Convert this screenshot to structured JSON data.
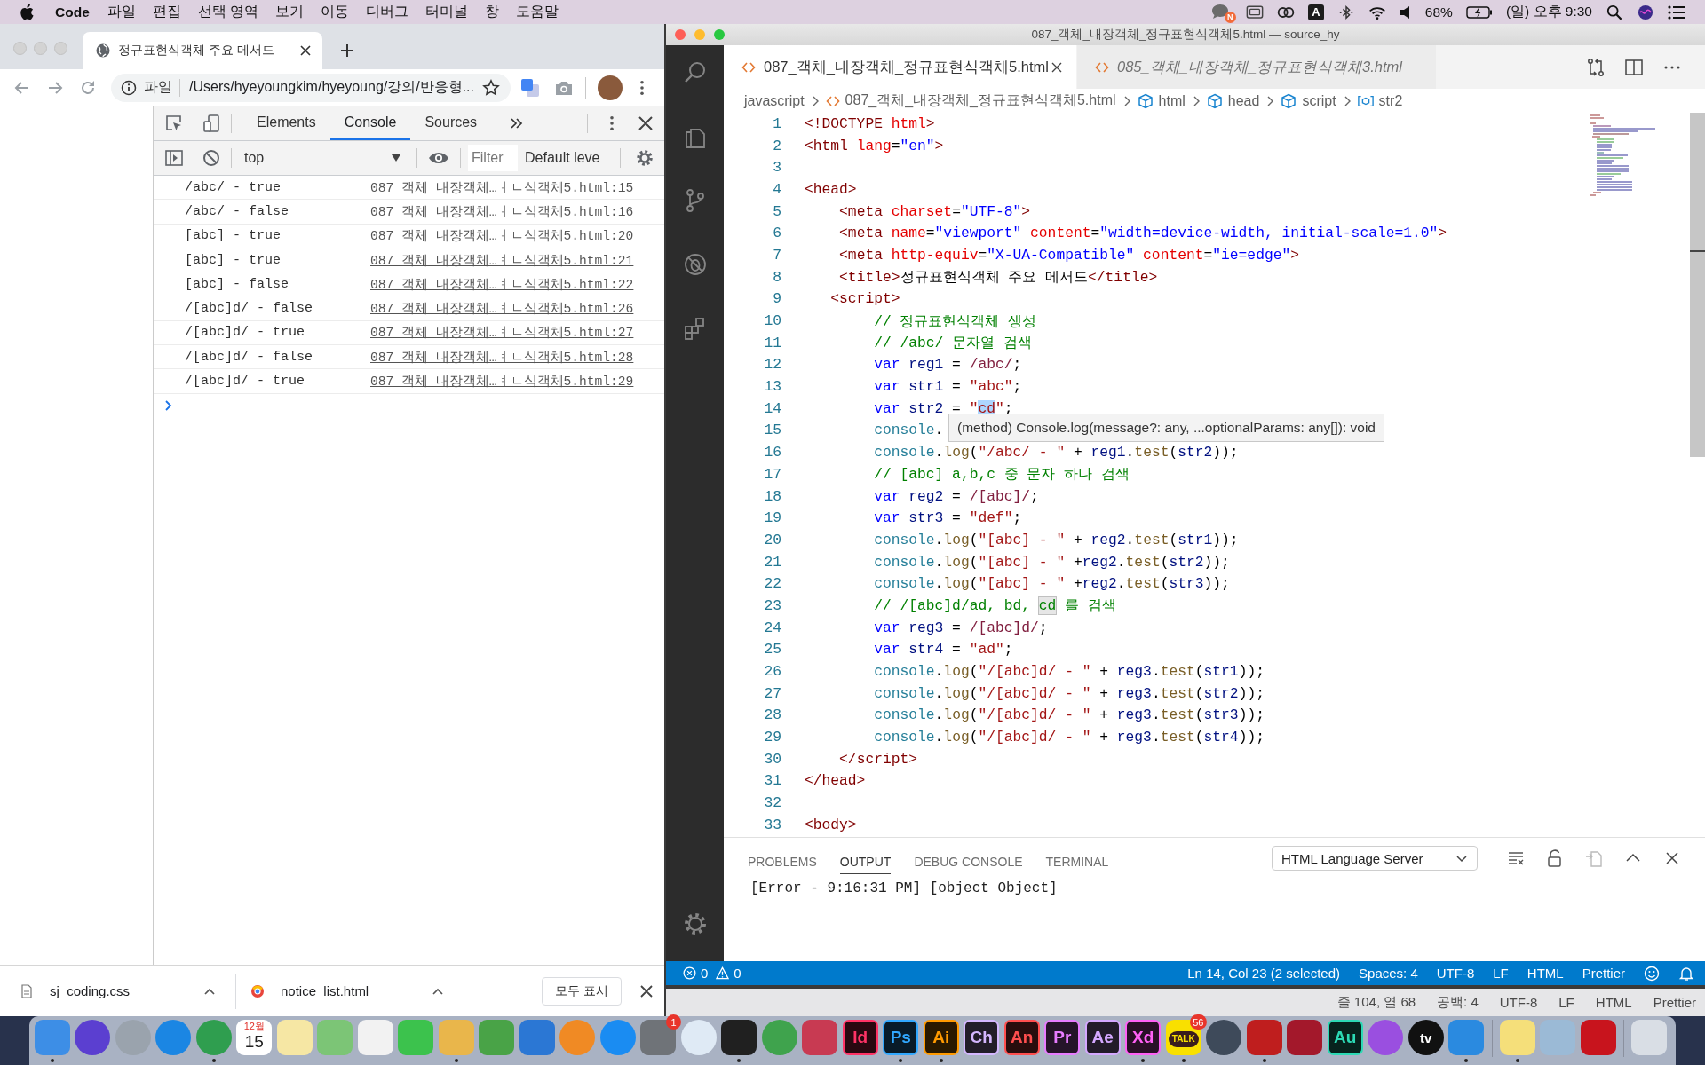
{
  "menu_bar": {
    "app_name": "Code",
    "menus": [
      "파일",
      "편집",
      "선택 영역",
      "보기",
      "이동",
      "디버그",
      "터미널",
      "창",
      "도움말"
    ],
    "chat_badge": "N",
    "input_source": "A",
    "battery": "68%",
    "clock": "(일) 오후 9:30"
  },
  "browser": {
    "tab_title": "정규표현식객체 주요 메서드",
    "address": {
      "scheme": "파일",
      "url": "/Users/hyeyoungkim/hyeyoung/강의/반응형..."
    },
    "devtools": {
      "tabs": [
        {
          "label": "Elements",
          "selected": false
        },
        {
          "label": "Console",
          "selected": true
        },
        {
          "label": "Sources",
          "selected": false
        }
      ],
      "context": "top",
      "filter": {
        "placeholder": "Filter"
      },
      "log_levels": "Default leve",
      "logs": [
        {
          "message": "/abc/ - true",
          "source": "087_객체_내장객체…ㅕㄴ식객체5.html:15"
        },
        {
          "message": "/abc/ - false",
          "source": "087_객체_내장객체…ㅕㄴ식객체5.html:16"
        },
        {
          "message": "[abc] - true",
          "source": "087_객체_내장객체…ㅕㄴ식객체5.html:20"
        },
        {
          "message": "[abc] - true",
          "source": "087_객체_내장객체…ㅕㄴ식객체5.html:21"
        },
        {
          "message": "[abc] - false",
          "source": "087_객체_내장객체…ㅕㄴ식객체5.html:22"
        },
        {
          "message": "/[abc]d/ - false",
          "source": "087_객체_내장객체…ㅕㄴ식객체5.html:26"
        },
        {
          "message": "/[abc]d/ - true",
          "source": "087_객체_내장객체…ㅕㄴ식객체5.html:27"
        },
        {
          "message": "/[abc]d/ - false",
          "source": "087_객체_내장객체…ㅕㄴ식객체5.html:28"
        },
        {
          "message": "/[abc]d/ - true",
          "source": "087_객체_내장객체…ㅕㄴ식객체5.html:29"
        }
      ]
    },
    "downloads": {
      "items": [
        {
          "name": "sj_coding.css",
          "kind": "css"
        },
        {
          "name": "notice_list.html",
          "kind": "html"
        }
      ],
      "show_all": "모두 표시"
    }
  },
  "editor_window": {
    "title": "087_객체_내장객체_정규표현식객체5.html — source_hy",
    "tabs": [
      {
        "label": "087_객체_내장객체_정규표현식객체5.html",
        "selected": true,
        "preview": false
      },
      {
        "label": "085_객체_내장객체_정규표현식객체3.html",
        "selected": false,
        "preview": true
      }
    ],
    "breadcrumb": [
      {
        "label": "javascript",
        "kind": "folder"
      },
      {
        "label": "087_객체_내장객체_정규표현식객체5.html",
        "kind": "file"
      },
      {
        "label": "html",
        "kind": "element"
      },
      {
        "label": "head",
        "kind": "element"
      },
      {
        "label": "script",
        "kind": "element"
      },
      {
        "label": "str2",
        "kind": "variable"
      }
    ],
    "lines": [
      {
        "number": "1",
        "tokens": [
          {
            "kind": "tag",
            "text": "<!DOCTYPE"
          },
          {
            "kind": "attr",
            "text": " html"
          },
          {
            "kind": "tag",
            "text": ">"
          }
        ]
      },
      {
        "number": "2",
        "tokens": [
          {
            "kind": "tag",
            "text": "<html"
          },
          {
            "kind": "attr",
            "text": " lang"
          },
          {
            "kind": "text",
            "text": "="
          },
          {
            "kind": "value",
            "text": "\"en\""
          },
          {
            "kind": "tag",
            "text": ">"
          }
        ]
      },
      {
        "number": "3"
      },
      {
        "number": "4",
        "tokens": [
          {
            "kind": "tag",
            "text": "<head>"
          }
        ]
      },
      {
        "number": "5",
        "tokens": [
          {
            "kind": "tag",
            "text": "    <meta"
          },
          {
            "kind": "attr",
            "text": " charset"
          },
          {
            "kind": "text",
            "text": "="
          },
          {
            "kind": "value",
            "text": "\"UTF-8\""
          },
          {
            "kind": "tag",
            "text": ">"
          }
        ]
      },
      {
        "number": "6",
        "tokens": [
          {
            "kind": "tag",
            "text": "    <meta"
          },
          {
            "kind": "attr",
            "text": " name"
          },
          {
            "kind": "text",
            "text": "="
          },
          {
            "kind": "value",
            "text": "\"viewport\""
          },
          {
            "kind": "attr",
            "text": " content"
          },
          {
            "kind": "text",
            "text": "="
          },
          {
            "kind": "value",
            "text": "\"width=device-width, initial-scale=1.0\""
          },
          {
            "kind": "tag",
            "text": ">"
          }
        ]
      },
      {
        "number": "7",
        "tokens": [
          {
            "kind": "tag",
            "text": "    <meta"
          },
          {
            "kind": "attr",
            "text": " http-equiv"
          },
          {
            "kind": "text",
            "text": "="
          },
          {
            "kind": "value",
            "text": "\"X-UA-Compatible\""
          },
          {
            "kind": "attr",
            "text": " content"
          },
          {
            "kind": "text",
            "text": "="
          },
          {
            "kind": "value",
            "text": "\"ie=edge\""
          },
          {
            "kind": "tag",
            "text": ">"
          }
        ]
      },
      {
        "number": "8",
        "tokens": [
          {
            "kind": "tag",
            "text": "    <title>"
          },
          {
            "kind": "text",
            "text": "정규표현식객체 주요 메서드"
          },
          {
            "kind": "tag",
            "text": "</title>"
          }
        ]
      },
      {
        "number": "9",
        "tokens": [
          {
            "kind": "tag",
            "text": "   <script>"
          }
        ]
      },
      {
        "number": "10",
        "tokens": [
          {
            "kind": "comment",
            "text": "        // 정규표현식객체 생성"
          }
        ]
      },
      {
        "number": "11",
        "tokens": [
          {
            "kind": "comment",
            "text": "        // /abc/ 문자열 검색"
          }
        ]
      },
      {
        "number": "12",
        "tokens": [
          {
            "kind": "keyword",
            "text": "        var"
          },
          {
            "kind": "variable",
            "text": " reg1"
          },
          {
            "kind": "text",
            "text": " = "
          },
          {
            "kind": "regex",
            "text": "/abc/"
          },
          {
            "kind": "text",
            "text": ";"
          }
        ]
      },
      {
        "number": "13",
        "tokens": [
          {
            "kind": "keyword",
            "text": "        var"
          },
          {
            "kind": "variable",
            "text": " str1"
          },
          {
            "kind": "text",
            "text": " = "
          },
          {
            "kind": "string",
            "text": "\"abc\""
          },
          {
            "kind": "text",
            "text": ";"
          }
        ]
      },
      {
        "number": "14",
        "tokens": [
          {
            "kind": "keyword",
            "text": "        var"
          },
          {
            "kind": "variable",
            "text": " str2"
          },
          {
            "kind": "text",
            "text": " = "
          },
          {
            "kind": "string",
            "text": "\""
          },
          {
            "kind": "selection",
            "text": "cd"
          },
          {
            "kind": "string",
            "text": "\""
          },
          {
            "kind": "text",
            "text": ";"
          }
        ]
      },
      {
        "number": "15",
        "tokens": [
          {
            "kind": "class",
            "text": "        console"
          },
          {
            "kind": "text",
            "text": "."
          }
        ]
      },
      {
        "number": "16",
        "tokens": [
          {
            "kind": "class",
            "text": "        console"
          },
          {
            "kind": "text",
            "text": "."
          },
          {
            "kind": "function",
            "text": "log"
          },
          {
            "kind": "text",
            "text": "("
          },
          {
            "kind": "string",
            "text": "\"/abc/ - \""
          },
          {
            "kind": "text",
            "text": " + "
          },
          {
            "kind": "variable",
            "text": "reg1"
          },
          {
            "kind": "text",
            "text": "."
          },
          {
            "kind": "function",
            "text": "test"
          },
          {
            "kind": "text",
            "text": "("
          },
          {
            "kind": "variable",
            "text": "str2"
          },
          {
            "kind": "text",
            "text": "));"
          }
        ]
      },
      {
        "number": "17",
        "tokens": [
          {
            "kind": "comment",
            "text": "        // [abc] a,b,c 중 문자 하나 검색"
          }
        ]
      },
      {
        "number": "18",
        "tokens": [
          {
            "kind": "keyword",
            "text": "        var"
          },
          {
            "kind": "variable",
            "text": " reg2"
          },
          {
            "kind": "text",
            "text": " = "
          },
          {
            "kind": "regex",
            "text": "/[abc]/"
          },
          {
            "kind": "text",
            "text": ";"
          }
        ]
      },
      {
        "number": "19",
        "tokens": [
          {
            "kind": "keyword",
            "text": "        var"
          },
          {
            "kind": "variable",
            "text": " str3"
          },
          {
            "kind": "text",
            "text": " = "
          },
          {
            "kind": "string",
            "text": "\"def\""
          },
          {
            "kind": "text",
            "text": ";"
          }
        ]
      },
      {
        "number": "20",
        "tokens": [
          {
            "kind": "class",
            "text": "        console"
          },
          {
            "kind": "text",
            "text": "."
          },
          {
            "kind": "function",
            "text": "log"
          },
          {
            "kind": "text",
            "text": "("
          },
          {
            "kind": "string",
            "text": "\"[abc] - \""
          },
          {
            "kind": "text",
            "text": " + "
          },
          {
            "kind": "variable",
            "text": "reg2"
          },
          {
            "kind": "text",
            "text": "."
          },
          {
            "kind": "function",
            "text": "test"
          },
          {
            "kind": "text",
            "text": "("
          },
          {
            "kind": "variable",
            "text": "str1"
          },
          {
            "kind": "text",
            "text": "));"
          }
        ]
      },
      {
        "number": "21",
        "tokens": [
          {
            "kind": "class",
            "text": "        console"
          },
          {
            "kind": "text",
            "text": "."
          },
          {
            "kind": "function",
            "text": "log"
          },
          {
            "kind": "text",
            "text": "("
          },
          {
            "kind": "string",
            "text": "\"[abc] - \""
          },
          {
            "kind": "text",
            "text": " +"
          },
          {
            "kind": "variable",
            "text": "reg2"
          },
          {
            "kind": "text",
            "text": "."
          },
          {
            "kind": "function",
            "text": "test"
          },
          {
            "kind": "text",
            "text": "("
          },
          {
            "kind": "variable",
            "text": "str2"
          },
          {
            "kind": "text",
            "text": "));"
          }
        ]
      },
      {
        "number": "22",
        "tokens": [
          {
            "kind": "class",
            "text": "        console"
          },
          {
            "kind": "text",
            "text": "."
          },
          {
            "kind": "function",
            "text": "log"
          },
          {
            "kind": "text",
            "text": "("
          },
          {
            "kind": "string",
            "text": "\"[abc] - \""
          },
          {
            "kind": "text",
            "text": " +"
          },
          {
            "kind": "variable",
            "text": "reg2"
          },
          {
            "kind": "text",
            "text": "."
          },
          {
            "kind": "function",
            "text": "test"
          },
          {
            "kind": "text",
            "text": "("
          },
          {
            "kind": "variable",
            "text": "str3"
          },
          {
            "kind": "text",
            "text": "));"
          }
        ]
      },
      {
        "number": "23",
        "tokens": [
          {
            "kind": "comment",
            "text": "        // /[abc]d/ad, bd, "
          },
          {
            "kind": "match",
            "text": "cd"
          },
          {
            "kind": "comment",
            "text": " 를 검색"
          }
        ]
      },
      {
        "number": "24",
        "tokens": [
          {
            "kind": "keyword",
            "text": "        var"
          },
          {
            "kind": "variable",
            "text": " reg3"
          },
          {
            "kind": "text",
            "text": " = "
          },
          {
            "kind": "regex",
            "text": "/[abc]d/"
          },
          {
            "kind": "text",
            "text": ";"
          }
        ]
      },
      {
        "number": "25",
        "tokens": [
          {
            "kind": "keyword",
            "text": "        var"
          },
          {
            "kind": "variable",
            "text": " str4"
          },
          {
            "kind": "text",
            "text": " = "
          },
          {
            "kind": "string",
            "text": "\"ad\""
          },
          {
            "kind": "text",
            "text": ";"
          }
        ]
      },
      {
        "number": "26",
        "tokens": [
          {
            "kind": "class",
            "text": "        console"
          },
          {
            "kind": "text",
            "text": "."
          },
          {
            "kind": "function",
            "text": "log"
          },
          {
            "kind": "text",
            "text": "("
          },
          {
            "kind": "string",
            "text": "\"/[abc]d/ - \""
          },
          {
            "kind": "text",
            "text": " + "
          },
          {
            "kind": "variable",
            "text": "reg3"
          },
          {
            "kind": "text",
            "text": "."
          },
          {
            "kind": "function",
            "text": "test"
          },
          {
            "kind": "text",
            "text": "("
          },
          {
            "kind": "variable",
            "text": "str1"
          },
          {
            "kind": "text",
            "text": "));"
          }
        ]
      },
      {
        "number": "27",
        "tokens": [
          {
            "kind": "class",
            "text": "        console"
          },
          {
            "kind": "text",
            "text": "."
          },
          {
            "kind": "function",
            "text": "log"
          },
          {
            "kind": "text",
            "text": "("
          },
          {
            "kind": "string",
            "text": "\"/[abc]d/ - \""
          },
          {
            "kind": "text",
            "text": " + "
          },
          {
            "kind": "variable",
            "text": "reg3"
          },
          {
            "kind": "text",
            "text": "."
          },
          {
            "kind": "function",
            "text": "test"
          },
          {
            "kind": "text",
            "text": "("
          },
          {
            "kind": "variable",
            "text": "str2"
          },
          {
            "kind": "text",
            "text": "));"
          }
        ]
      },
      {
        "number": "28",
        "tokens": [
          {
            "kind": "class",
            "text": "        console"
          },
          {
            "kind": "text",
            "text": "."
          },
          {
            "kind": "function",
            "text": "log"
          },
          {
            "kind": "text",
            "text": "("
          },
          {
            "kind": "string",
            "text": "\"/[abc]d/ - \""
          },
          {
            "kind": "text",
            "text": " + "
          },
          {
            "kind": "variable",
            "text": "reg3"
          },
          {
            "kind": "text",
            "text": "."
          },
          {
            "kind": "function",
            "text": "test"
          },
          {
            "kind": "text",
            "text": "("
          },
          {
            "kind": "variable",
            "text": "str3"
          },
          {
            "kind": "text",
            "text": "));"
          }
        ]
      },
      {
        "number": "29",
        "tokens": [
          {
            "kind": "class",
            "text": "        console"
          },
          {
            "kind": "text",
            "text": "."
          },
          {
            "kind": "function",
            "text": "log"
          },
          {
            "kind": "text",
            "text": "("
          },
          {
            "kind": "string",
            "text": "\"/[abc]d/ - \""
          },
          {
            "kind": "text",
            "text": " + "
          },
          {
            "kind": "variable",
            "text": "reg3"
          },
          {
            "kind": "text",
            "text": "."
          },
          {
            "kind": "function",
            "text": "test"
          },
          {
            "kind": "text",
            "text": "("
          },
          {
            "kind": "variable",
            "text": "str4"
          },
          {
            "kind": "text",
            "text": "));"
          }
        ]
      },
      {
        "number": "30",
        "tokens": [
          {
            "kind": "tag",
            "text": "    </script>"
          }
        ]
      },
      {
        "number": "31",
        "tokens": [
          {
            "kind": "tag",
            "text": "</head>"
          }
        ]
      },
      {
        "number": "32"
      },
      {
        "number": "33",
        "tokens": [
          {
            "kind": "tag",
            "text": "<body>"
          }
        ]
      }
    ],
    "hover_tooltip": "(method) Console.log(message?: any, ...optionalParams: any[]): void",
    "panel": {
      "tabs": [
        {
          "label": "PROBLEMS",
          "selected": false
        },
        {
          "label": "OUTPUT",
          "selected": true
        },
        {
          "label": "DEBUG CONSOLE",
          "selected": false
        },
        {
          "label": "TERMINAL",
          "selected": false
        }
      ],
      "channel": "HTML Language Server",
      "output": "[Error - 9:16:31 PM] [object Object]"
    },
    "status_bar": {
      "errors": "0",
      "warnings": "0",
      "items": [
        "Ln 14, Col 23 (2 selected)",
        "Spaces: 4",
        "UTF-8",
        "LF",
        "HTML",
        "Prettier"
      ]
    }
  },
  "background_status_bar": {
    "items": [
      "줄 104, 열 68",
      "공백: 4",
      "UTF-8",
      "LF",
      "HTML",
      "Prettier"
    ]
  },
  "dock": {
    "items": [
      {
        "kind": "tile",
        "color": "#3d8ee6",
        "running": true
      },
      {
        "kind": "round",
        "color": "#5b3fd0",
        "running": false
      },
      {
        "kind": "round",
        "color": "#9aa3ad",
        "running": false
      },
      {
        "kind": "round",
        "color": "#1b86e3",
        "running": false
      },
      {
        "kind": "round",
        "color": "#2f9e4f",
        "running": true
      },
      {
        "kind": "calendar",
        "month": "12월",
        "day": "15",
        "running": false
      },
      {
        "kind": "tile",
        "color": "#f6e7a4",
        "running": false
      },
      {
        "kind": "tile",
        "color": "#7cc576",
        "running": false
      },
      {
        "kind": "tile",
        "color": "#f2f2f2",
        "running": false
      },
      {
        "kind": "tile",
        "color": "#3cc24d",
        "running": false
      },
      {
        "kind": "tile",
        "color": "#e9b64b",
        "running": true
      },
      {
        "kind": "tile",
        "color": "#49a347",
        "running": false
      },
      {
        "kind": "tile",
        "color": "#2b77d4",
        "running": false
      },
      {
        "kind": "round",
        "color": "#f08a24",
        "running": false
      },
      {
        "kind": "round",
        "color": "#1a8cf2",
        "running": false
      },
      {
        "kind": "tile",
        "color": "#6f7378",
        "badge": "1",
        "running": false
      },
      {
        "kind": "round",
        "color": "#dfeaf5",
        "running": false
      },
      {
        "kind": "tile",
        "color": "#202020",
        "running": true
      },
      {
        "kind": "round",
        "color": "#3fa34d",
        "running": false
      },
      {
        "kind": "tile",
        "color": "#c83a52",
        "running": false
      },
      {
        "kind": "letters",
        "text": "Id",
        "color": "#ff3366",
        "running": false
      },
      {
        "kind": "letters",
        "text": "Ps",
        "color": "#31a8ff",
        "running": true
      },
      {
        "kind": "letters",
        "text": "Ai",
        "color": "#ff9a00",
        "running": true
      },
      {
        "kind": "letters",
        "text": "Ch",
        "color": "#d4b7ff",
        "running": false
      },
      {
        "kind": "letters",
        "text": "An",
        "color": "#ff4f4f",
        "running": false
      },
      {
        "kind": "letters",
        "text": "Pr",
        "color": "#e77cff",
        "running": false
      },
      {
        "kind": "letters",
        "text": "Ae",
        "color": "#d4a8ff",
        "running": false
      },
      {
        "kind": "letters",
        "text": "Xd",
        "color": "#ff61f6",
        "running": true
      },
      {
        "kind": "talk",
        "text": "TALK",
        "color": "#f9e000",
        "badge": "56",
        "running": true
      },
      {
        "kind": "round",
        "color": "#3e4a5a",
        "running": false
      },
      {
        "kind": "tile",
        "color": "#bf1e1e",
        "running": true
      },
      {
        "kind": "tile",
        "color": "#a3182b",
        "running": false
      },
      {
        "kind": "letters",
        "text": "Au",
        "color": "#2cd9b4",
        "running": false
      },
      {
        "kind": "round",
        "color": "#9a4fe0",
        "running": false
      },
      {
        "kind": "tv",
        "text": "tv",
        "color": "#111111",
        "running": false
      },
      {
        "kind": "tile",
        "color": "#2a8ae0",
        "running": true
      },
      {
        "kind": "separator"
      },
      {
        "kind": "tile",
        "color": "#f5df7a",
        "running": true
      },
      {
        "kind": "tile",
        "color": "#9bbad6",
        "running": false
      },
      {
        "kind": "tile",
        "color": "#c8141d",
        "running": false
      },
      {
        "kind": "separator"
      },
      {
        "kind": "tile",
        "color": "#d9dee5",
        "running": false
      }
    ]
  }
}
